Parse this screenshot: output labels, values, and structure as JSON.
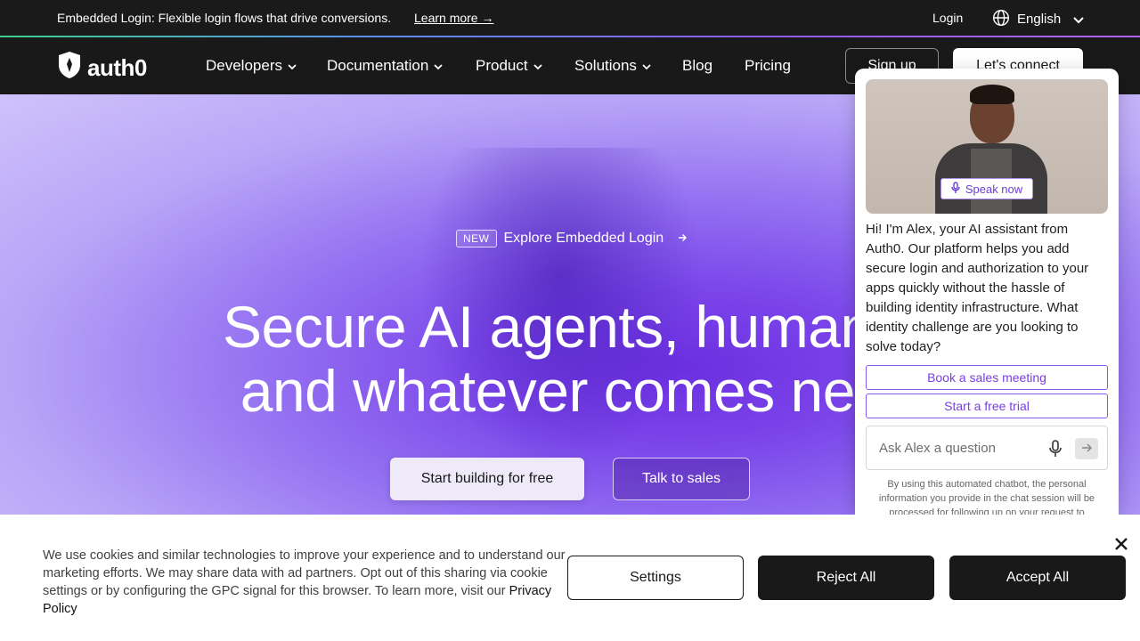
{
  "announcement": {
    "message": "Embedded Login: Flexible login flows that drive conversions.",
    "learn_more": "Learn more →",
    "login": "Login",
    "language": "English"
  },
  "nav": {
    "logo_text": "auth0",
    "items": [
      {
        "label": "Developers",
        "dropdown": true
      },
      {
        "label": "Documentation",
        "dropdown": true
      },
      {
        "label": "Product",
        "dropdown": true
      },
      {
        "label": "Solutions",
        "dropdown": true
      },
      {
        "label": "Blog",
        "dropdown": false
      },
      {
        "label": "Pricing",
        "dropdown": false
      }
    ],
    "signup": "Sign up",
    "connect": "Let's connect"
  },
  "hero": {
    "badge": "NEW",
    "badge_link": "Explore Embedded Login",
    "headline_line1": "Secure AI agents, humans,",
    "headline_line2": "and whatever comes next",
    "cta_primary": "Start building for free",
    "cta_secondary": "Talk to sales"
  },
  "chat": {
    "speak_now": "Speak now",
    "message": "Hi! I'm Alex, your AI assistant from Auth0. Our platform helps you add secure login and authorization to your apps quickly without the hassle of building identity infrastructure. What identity challenge are you looking to solve today?",
    "options": [
      "Book a sales meeting",
      "Start a free trial"
    ],
    "input_placeholder": "Ask Alex a question",
    "disclaimer": "By using this automated chatbot, the personal information you provide in the chat session will be processed for following up on your request to"
  },
  "cookie": {
    "text": "We use cookies and similar technologies to improve your experience and to understand our marketing efforts. We may share data with ad partners. Opt out of this sharing via cookie settings or by configuring the GPC signal for this browser. To learn more, visit our",
    "policy_link": "Privacy Policy",
    "settings": "Settings",
    "reject": "Reject All",
    "accept": "Accept All"
  },
  "colors": {
    "nav_bg": "#191919",
    "accent_purple": "#7a3ee0",
    "hero_purple": "#6b2fe0"
  }
}
